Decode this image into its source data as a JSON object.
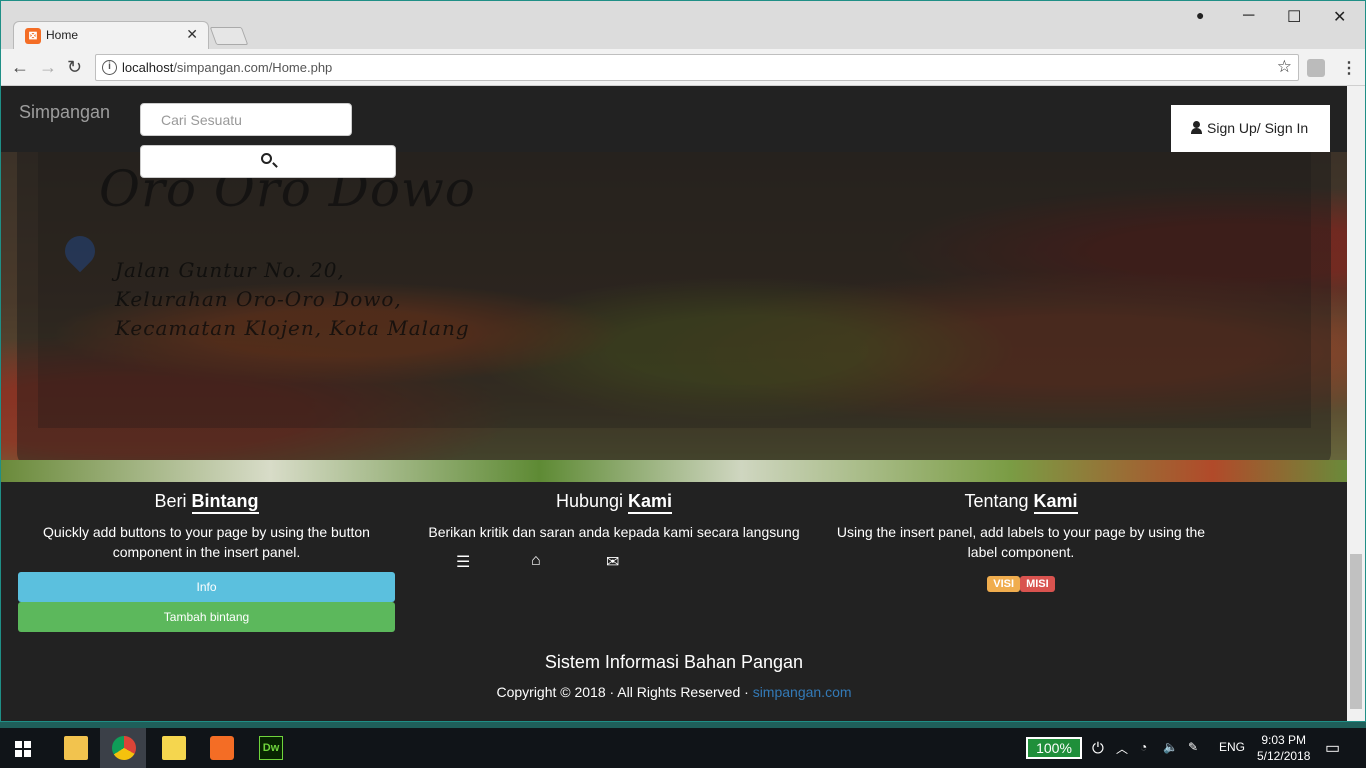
{
  "browser": {
    "tab_title": "Home",
    "url_host": "localhost",
    "url_path": "/simpangan.com/Home.php"
  },
  "site": {
    "brand": "Simpangan",
    "search_placeholder": "Cari Sesuatu",
    "signin_label": "Sign Up/ Sign In"
  },
  "hero": {
    "title": "Oro Oro Dowo",
    "address": [
      "Jalan Guntur No. 20,",
      "Kelurahan Oro-Oro Dowo,",
      "Kecamatan Klojen, Kota Malang"
    ]
  },
  "footer": {
    "col1": {
      "title_a": "Beri",
      "title_b": "Bintang",
      "text": "Quickly add buttons to your page by using the button component in the insert panel.",
      "btn_info": "Info",
      "btn_add": "Tambah bintang"
    },
    "col2": {
      "title_a": "Hubungi",
      "title_b": "Kami",
      "text": "Berikan kritik dan saran anda kepada kami secara langsung",
      "icons": [
        "list-icon",
        "home-icon",
        "envelope-icon"
      ]
    },
    "col3": {
      "title_a": "Tentang",
      "title_b": "Kami",
      "text": "Using the insert panel, add labels to your page by using the label component.",
      "badge_visi": "VISI",
      "badge_misi": "MISI"
    },
    "site_name": "Sistem Informasi Bahan Pangan",
    "copyright": "Copyright © 2018 · All Rights Reserved · ",
    "link": "simpangan.com"
  },
  "taskbar": {
    "battery": "100%",
    "lang": "ENG",
    "time": "9:03 PM",
    "date": "5/12/2018"
  },
  "colors": {
    "info": "#5bc0de",
    "success": "#5cb85c",
    "visi": "#f0ad4e",
    "misi": "#d9534f",
    "link": "#337ab7"
  }
}
